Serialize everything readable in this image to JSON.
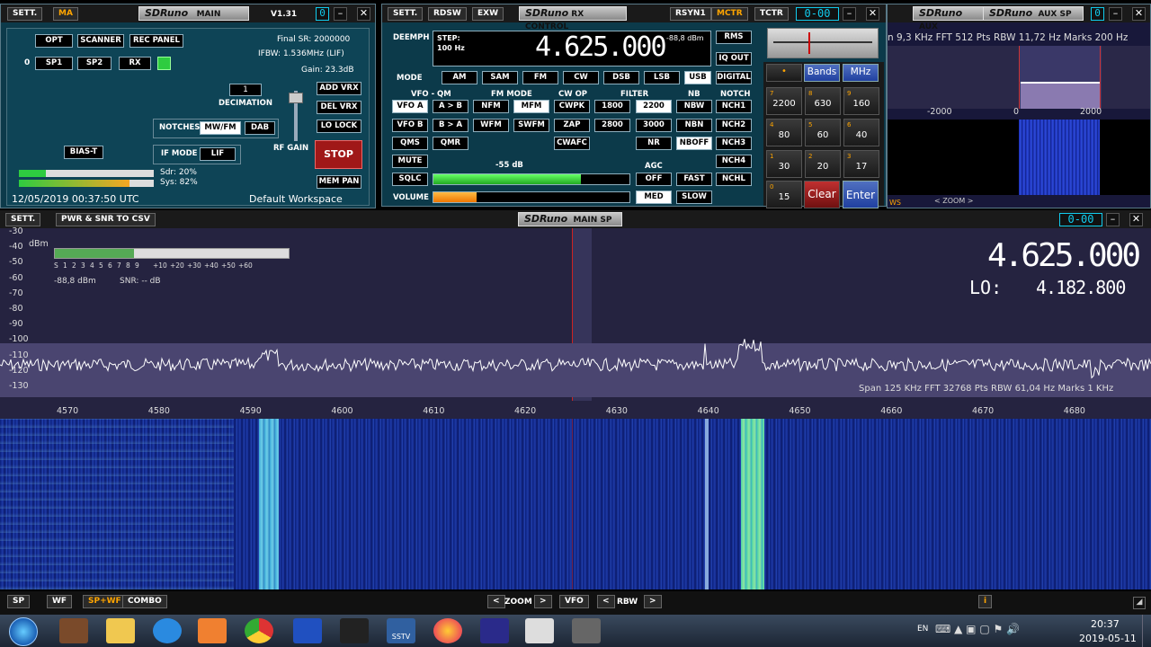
{
  "main_panel": {
    "sett": "SETT.",
    "ma": "MA",
    "logo_brand": "SDRuno",
    "logo_title": "MAIN",
    "version": "V1.31",
    "cyan_indicator": "0",
    "buttons": {
      "opt": "OPT",
      "scanner": "SCANNER",
      "rec_panel": "REC PANEL",
      "sp1": "SP1",
      "sp2": "SP2",
      "rx": "RX",
      "bias_t": "BIAS-T",
      "add_vrx": "ADD VRX",
      "del_vrx": "DEL VRX",
      "lo_lock": "LO LOCK",
      "stop": "STOP",
      "mem_pan": "MEM PAN",
      "notches": "NOTCHES",
      "mwfm": "MW/FM",
      "dab": "DAB",
      "if_mode": "IF MODE",
      "lif": "LIF"
    },
    "rx_index": "0",
    "final_sr": "Final SR: 2000000",
    "ifbw": "IFBW: 1.536MHz (LIF)",
    "gain": "Gain: 23.3dB",
    "decimation_value": "1",
    "decimation_label": "DECIMATION",
    "rf_gain": "RF GAIN",
    "sdr": "Sdr: 20%",
    "sys": "Sys: 82%",
    "datetime": "12/05/2019 00:37:50 UTC",
    "workspace": "Default Workspace"
  },
  "rx_control": {
    "sett": "SETT.",
    "rdsw": "RDSW",
    "exw": "EXW",
    "logo_brand": "SDRuno",
    "logo_title": "RX CONTROL",
    "rsyn1": "RSYN1",
    "mctr": "MCTR",
    "tctr": "TCTR",
    "cyan_indicator": "0-00",
    "deemph": "DEEMPH",
    "step_label": "STEP:",
    "step_value": "100 Hz",
    "frequency": "4.625.000",
    "level": "-88,8 dBm",
    "rms": "RMS",
    "iq_out": "IQ OUT",
    "mode_label": "MODE",
    "modes": [
      "AM",
      "SAM",
      "FM",
      "CW",
      "DSB",
      "LSB",
      "USB",
      "DIGITAL"
    ],
    "vfo_qm": "VFO - QM",
    "fm_mode": "FM MODE",
    "cw_op": "CW OP",
    "filter": "FILTER",
    "nb": "NB",
    "notch": "NOTCH",
    "row1": [
      "VFO A",
      "A > B",
      "NFM",
      "MFM",
      "CWPK",
      "1800",
      "2200",
      "NBW",
      "NCH1"
    ],
    "row2": [
      "VFO B",
      "B > A",
      "WFM",
      "SWFM",
      "ZAP",
      "2800",
      "3000",
      "NBN",
      "NCH2"
    ],
    "row3": [
      "QMS",
      "QMR",
      "CWAFC",
      "NR",
      "NBOFF",
      "NCH3"
    ],
    "mute": "MUTE",
    "sqlc_db": "-55 dB",
    "agc": "AGC",
    "nch4": "NCH4",
    "sqlc": "SQLC",
    "off": "OFF",
    "fast": "FAST",
    "nchl": "NCHL",
    "volume": "VOLUME",
    "med": "MED",
    "slow": "SLOW"
  },
  "keypad": {
    "bands": "Bands",
    "mhz": "MHz",
    "keys": [
      {
        "n": "7",
        "v": "2200"
      },
      {
        "n": "8",
        "v": "630"
      },
      {
        "n": "9",
        "v": "160"
      },
      {
        "n": "4",
        "v": "80"
      },
      {
        "n": "5",
        "v": "60"
      },
      {
        "n": "6",
        "v": "40"
      },
      {
        "n": "1",
        "v": "30"
      },
      {
        "n": "2",
        "v": "20"
      },
      {
        "n": "3",
        "v": "17"
      }
    ],
    "zero_label": "0",
    "zero_value": "15",
    "clear": "Clear",
    "enter": "Enter"
  },
  "aux_sp": {
    "logo_brand": "SDRuno",
    "aux_title_cut": "AUX",
    "logo_title": "AUX SP",
    "cyan_indicator": "0",
    "info": "n 9,3 KHz  FFT 512 Pts  RBW 11,72 Hz  Marks 200 Hz",
    "ticks": [
      "-2000",
      "0",
      "2000"
    ],
    "zoom": "ZOOM",
    "ws": "WS"
  },
  "main_sp": {
    "sett": "SETT.",
    "pwr_csv": "PWR & SNR TO CSV",
    "logo_brand": "SDRuno",
    "logo_title": "MAIN SP",
    "cyan_indicator": "0-00",
    "dbm_label": "dBm",
    "db_ticks": [
      "-30",
      "-40",
      "-50",
      "-60",
      "-70",
      "-80",
      "-90",
      "-100",
      "-110",
      "-120",
      "-130"
    ],
    "smeter_ticks": [
      "S",
      "1",
      "2",
      "3",
      "4",
      "5",
      "6",
      "7",
      "8",
      "9",
      "+10",
      "+20",
      "+30",
      "+40",
      "+50",
      "+60"
    ],
    "meter_dbm": "-88,8 dBm",
    "snr": "SNR: -- dB",
    "frequency": "4.625.000",
    "lo_label": "LO:",
    "lo_value": "4.182.800",
    "info": "Span 125 KHz   FFT 32768 Pts   RBW 61,04 Hz   Marks 1 KHz",
    "freq_ticks": [
      "4570",
      "4580",
      "4590",
      "4600",
      "4610",
      "4620",
      "4630",
      "4640",
      "4650",
      "4660",
      "4670",
      "4680"
    ],
    "bottom": {
      "sp": "SP",
      "wf": "WF",
      "spwf": "SP+WF",
      "combo": "COMBO",
      "zoom": "ZOOM",
      "vfo": "VFO",
      "rbw": "RBW",
      "lt": "<",
      "gt": ">",
      "info": "i"
    }
  },
  "taskbar": {
    "lang": "EN",
    "time": "20:37",
    "date": "2019-05-11",
    "sstv": "SSTV"
  }
}
